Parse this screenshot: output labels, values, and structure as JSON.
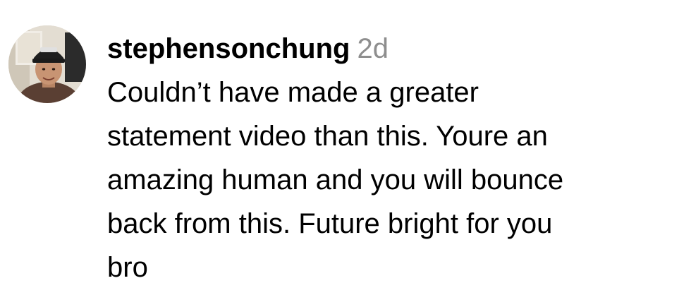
{
  "comment": {
    "username": "stephensonchung",
    "timestamp": "2d",
    "body_lines": [
      "Couldn’t have made a greater",
      "statement video than this. Youre an",
      "amazing human and you will bounce",
      "back from this. Future bright for you",
      "bro"
    ]
  },
  "avatar": {
    "icon": "user-avatar-photo"
  }
}
